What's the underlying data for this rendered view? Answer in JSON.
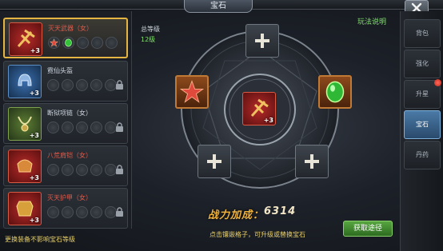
{
  "header": {
    "title": "宝石"
  },
  "equipment": [
    {
      "name": "灭天武器（女）",
      "plus": "+3",
      "color": "red",
      "gems": [
        "star",
        "green",
        "",
        "",
        ""
      ],
      "locked": false,
      "selected": true
    },
    {
      "name": "霓仙头盔",
      "plus": "+3",
      "color": "blue",
      "gems": [
        "",
        "",
        "",
        "",
        ""
      ],
      "locked": true,
      "selected": false
    },
    {
      "name": "断狱项链（女）",
      "plus": "+3",
      "color": "green",
      "gems": [
        "",
        "",
        "",
        "",
        ""
      ],
      "locked": true,
      "selected": false
    },
    {
      "name": "八荒肩铠（女）",
      "plus": "+3",
      "color": "red",
      "gems": [
        "",
        "",
        "",
        "",
        ""
      ],
      "locked": true,
      "selected": false
    },
    {
      "name": "灭天护甲（女）",
      "plus": "+3",
      "color": "red",
      "gems": [
        "",
        "",
        "",
        "",
        ""
      ],
      "locked": true,
      "selected": false
    }
  ],
  "footer_note": "更换装备不影响宝石等级",
  "total_level": {
    "label": "总等级",
    "value": "12级"
  },
  "help_link": "玩法说明",
  "center_item": {
    "plus": "+3"
  },
  "sockets": [
    {
      "pos": "top",
      "state": "empty",
      "icon": "plus-icon"
    },
    {
      "pos": "left",
      "state": "filled",
      "icon": "star-gem-icon"
    },
    {
      "pos": "right",
      "state": "filled",
      "icon": "green-gem-icon"
    },
    {
      "pos": "bottom-left",
      "state": "empty",
      "icon": "plus-icon"
    },
    {
      "pos": "bottom-right",
      "state": "empty",
      "icon": "plus-icon"
    }
  ],
  "power": {
    "label": "战力加成：",
    "value": "6314"
  },
  "hint": "点击镶嵌格子，可升级或替换宝石",
  "get_button": "获取途径",
  "tabs": [
    {
      "label": "背包",
      "active": false
    },
    {
      "label": "强化",
      "active": false
    },
    {
      "label": "升星",
      "active": false,
      "badge": true
    },
    {
      "label": "宝石",
      "active": true
    },
    {
      "label": "丹药",
      "active": false
    }
  ],
  "colors": {
    "gold": "#e5b544",
    "green_text": "#7fe06a",
    "yellow_text": "#e8d06a",
    "active_tab": "#4a7aa6"
  }
}
